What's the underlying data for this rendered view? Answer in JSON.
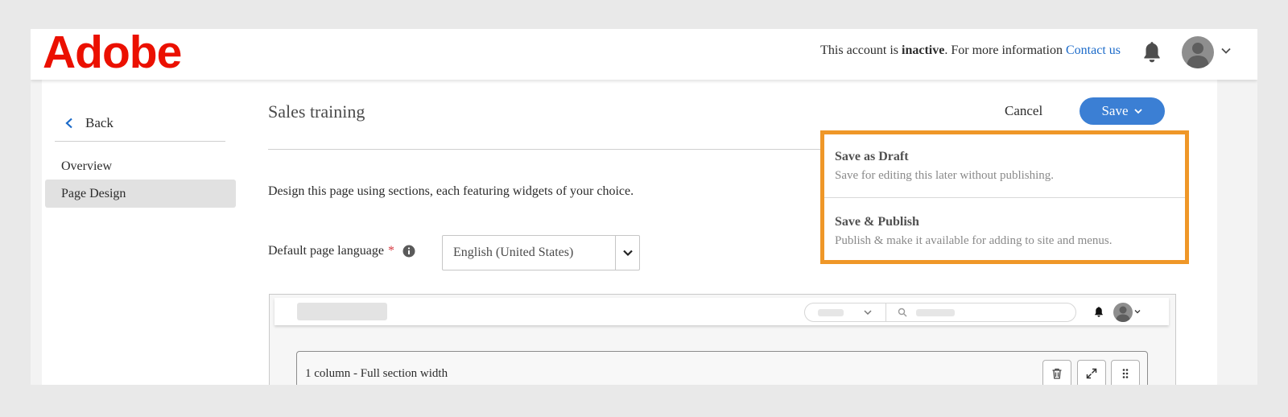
{
  "header": {
    "logo_text": "Adobe",
    "account_prefix": "This account is ",
    "account_status": "inactive",
    "account_suffix": ". For more information ",
    "contact_link": "Contact us",
    "brand_color": "#eb1000",
    "link_color": "#1b6ac9"
  },
  "sidebar": {
    "back_label": "Back",
    "items": [
      {
        "label": "Overview",
        "active": false
      },
      {
        "label": "Page Design",
        "active": true
      }
    ]
  },
  "main": {
    "title": "Sales training",
    "cancel_label": "Cancel",
    "save_label": "Save",
    "save_color": "#3b7fd4",
    "intro": "Design this page using sections, each featuring widgets of your choice.",
    "language_label": "Default page language",
    "required_mark": "*",
    "language_value": "English (United States)"
  },
  "preview": {
    "section_label": "1 column - Full section width"
  },
  "save_menu": {
    "highlight_color": "#ef9728",
    "items": [
      {
        "title": "Save as Draft",
        "description": "Save for editing this later without publishing."
      },
      {
        "title": "Save & Publish",
        "description": "Publish & make it available for adding to site and menus."
      }
    ]
  },
  "icons": [
    "bell-icon",
    "avatar",
    "chevron-down-icon",
    "chevron-left-icon",
    "info-icon",
    "search-icon",
    "trash-icon",
    "expand-icon",
    "drag-handle-icon"
  ]
}
